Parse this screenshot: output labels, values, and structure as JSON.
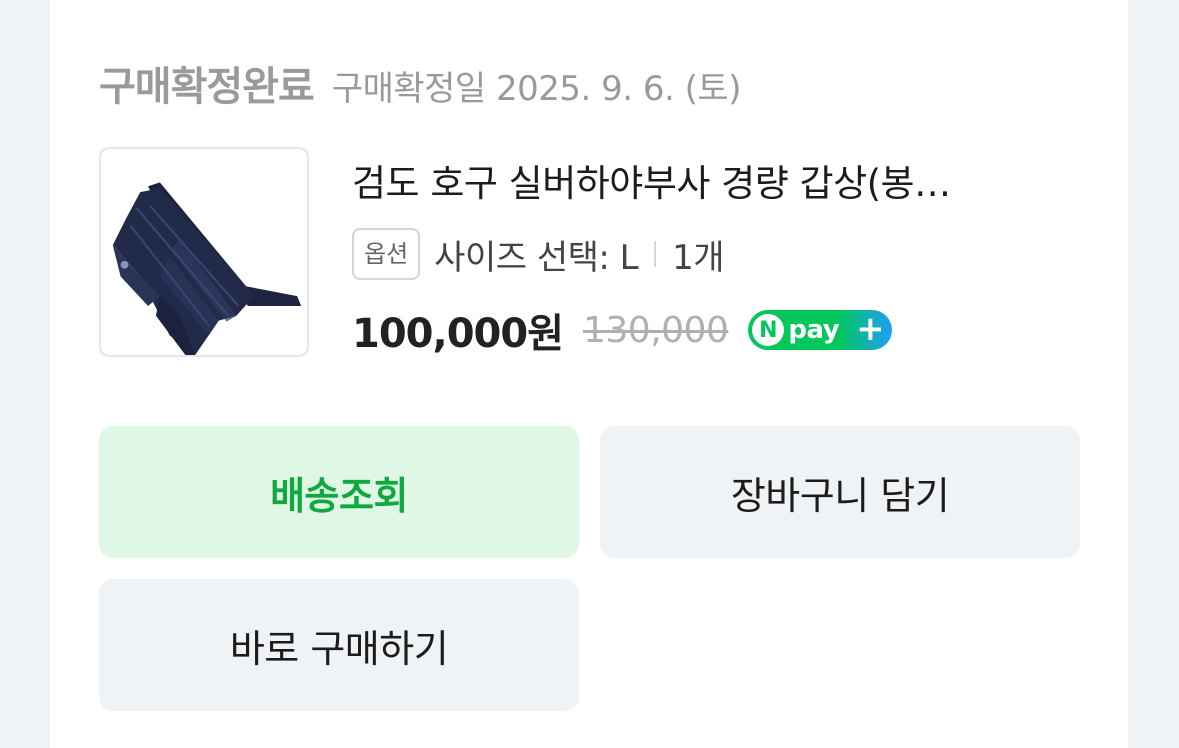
{
  "order": {
    "status_title": "구매확정완료",
    "status_date": "구매확정일 2025. 9. 6. (토)"
  },
  "product": {
    "title": "검도 호구 실버하야부사 경량 갑상(봉…",
    "option_badge": "옵션",
    "option_text": "사이즈 선택: L",
    "quantity": "1개",
    "price": "100,000원",
    "original_price": "130,000",
    "npay_badge": {
      "n": "N",
      "text": "pay",
      "plus": "+"
    },
    "image_icon": "kendo-tare-armor-image"
  },
  "buttons": {
    "track_delivery": "배송조회",
    "add_to_cart": "장바구니 담기",
    "buy_now": "바로 구매하기"
  },
  "colors": {
    "accent_green": "#03c75a",
    "track_button_bg": "#dff7e5",
    "track_button_text": "#11a83e",
    "npay_blue": "#1e9ef5"
  }
}
